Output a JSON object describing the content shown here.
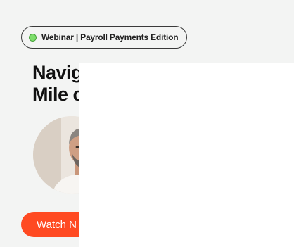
{
  "badge": {
    "label": "Webinar | Payroll Payments Edition",
    "dot_color": "#7dde6b"
  },
  "headline": {
    "line1": "Navig",
    "line2": "Mile c"
  },
  "avatar": {
    "icon": "person-photo"
  },
  "cta": {
    "label": "Watch N",
    "color": "#ff4a22"
  }
}
